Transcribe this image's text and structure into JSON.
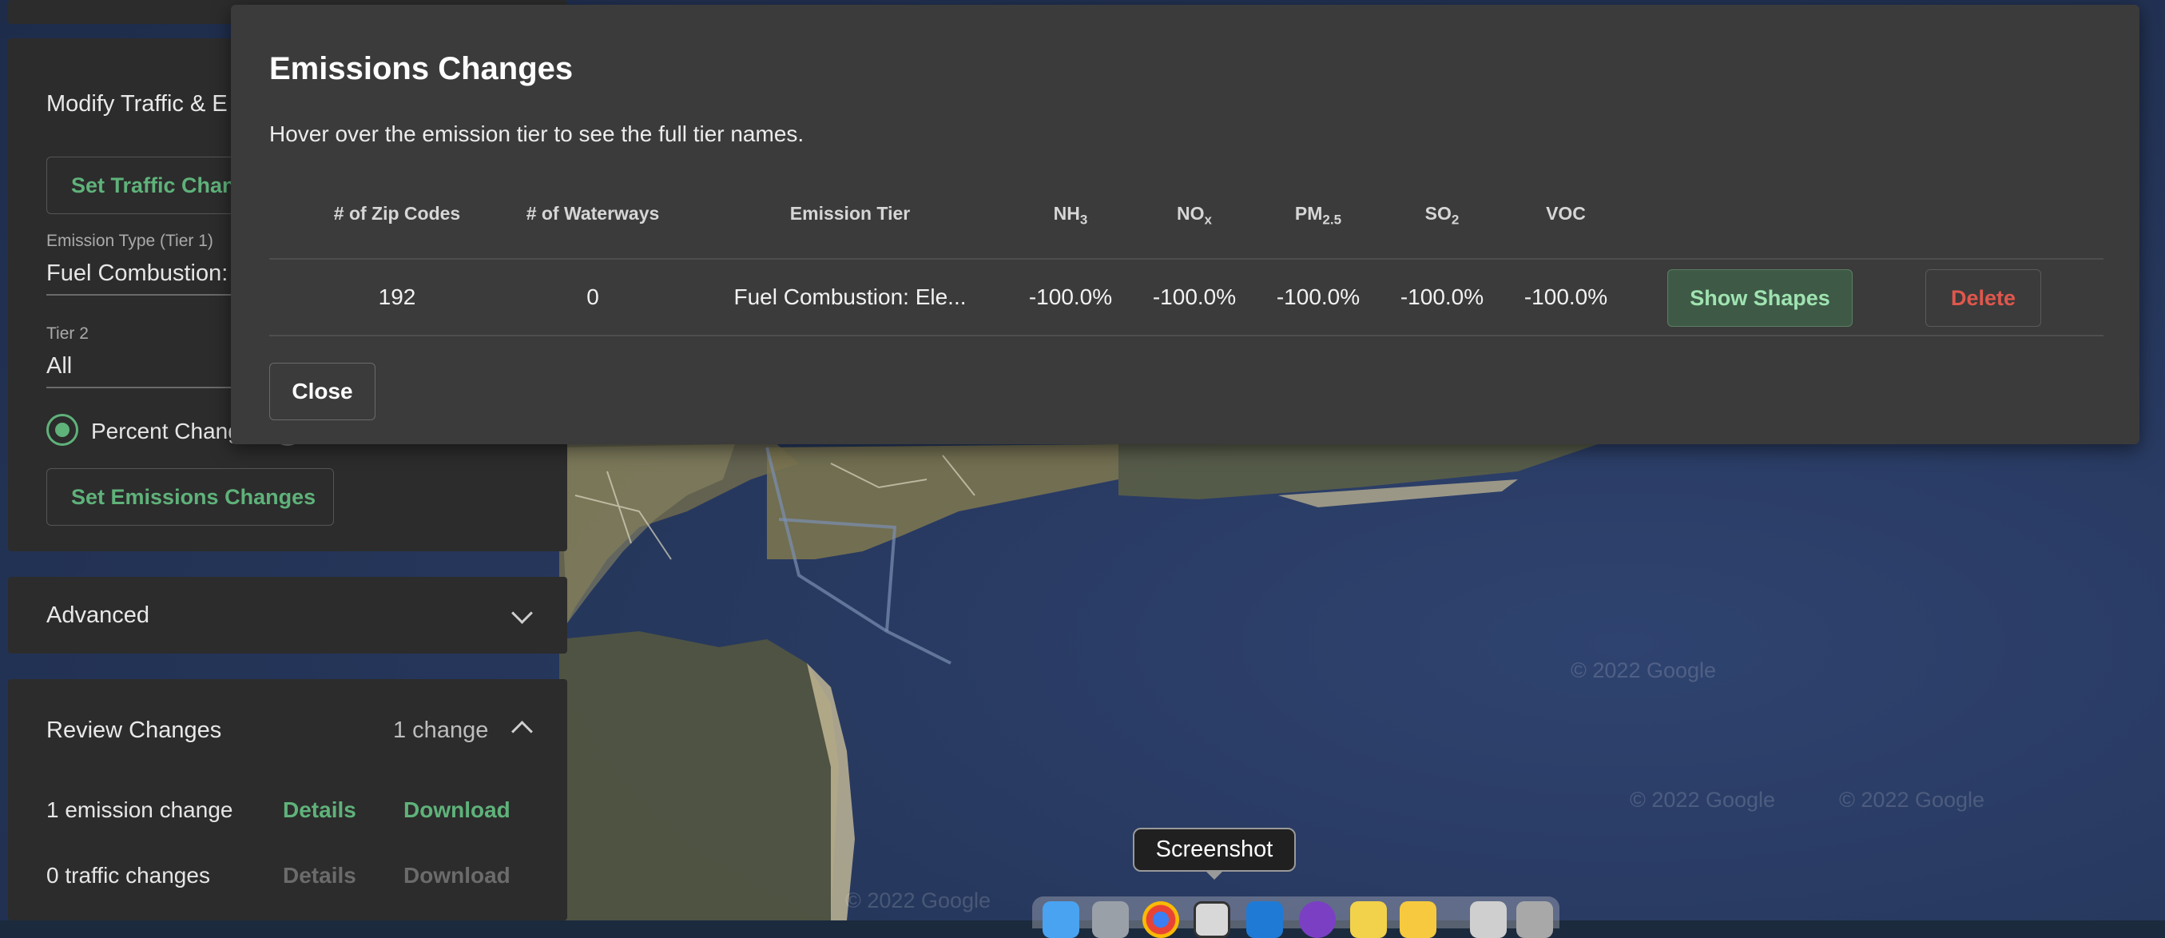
{
  "panel": {
    "modify_title": "Modify Traffic & E",
    "set_traffic_label": "Set Traffic Chan",
    "emission_type_label": "Emission Type (Tier 1)",
    "emission_type_value": "Fuel Combustion: E",
    "tier2_label": "Tier 2",
    "tier2_value": "All",
    "percent_change_label": "Percent Chang",
    "set_emissions_label": "Set Emissions Changes",
    "advanced_title": "Advanced",
    "review_title": "Review Changes",
    "review_count": "1 change",
    "rows": [
      {
        "label": "1 emission change",
        "details": "Details",
        "download": "Download",
        "enabled": true
      },
      {
        "label": "0 traffic changes",
        "details": "Details",
        "download": "Download",
        "enabled": false
      }
    ]
  },
  "modal": {
    "title": "Emissions Changes",
    "subtitle": "Hover over the emission tier to see the full tier names.",
    "headers": {
      "zip_codes": "# of Zip Codes",
      "waterways": "# of Waterways",
      "emission_tier": "Emission Tier",
      "nh3_base": "NH",
      "nh3_sub": "3",
      "nox_base": "NO",
      "nox_sub": "x",
      "pm_base": "PM",
      "pm_sub": "2.5",
      "so2_base": "SO",
      "so2_sub": "2",
      "voc": "VOC"
    },
    "row": {
      "zip_codes": "192",
      "waterways": "0",
      "emission_tier": "Fuel Combustion: Ele...",
      "nh3": "-100.0%",
      "nox": "-100.0%",
      "pm25": "-100.0%",
      "so2": "-100.0%",
      "voc": "-100.0%",
      "show_shapes_label": "Show Shapes",
      "delete_label": "Delete"
    },
    "close_label": "Close"
  },
  "map": {
    "watermarks": [
      "© 2022 Google",
      "© 2022 Google",
      "© 2022 Google",
      "© 2022 Google"
    ]
  },
  "dock": {
    "tooltip": "Screenshot",
    "icons": [
      "finder-icon",
      "launchpad-icon",
      "chrome-icon",
      "screenshot-icon",
      "vscode-icon",
      "github-desktop-icon",
      "stickies-icon",
      "notes-icon",
      "preview-icon",
      "trash-icon"
    ]
  },
  "colors": {
    "accent_green": "#5fb27a",
    "delete_red": "#e0574d",
    "modal_bg": "#3b3b3b",
    "panel_bg": "#2c2c2c"
  }
}
